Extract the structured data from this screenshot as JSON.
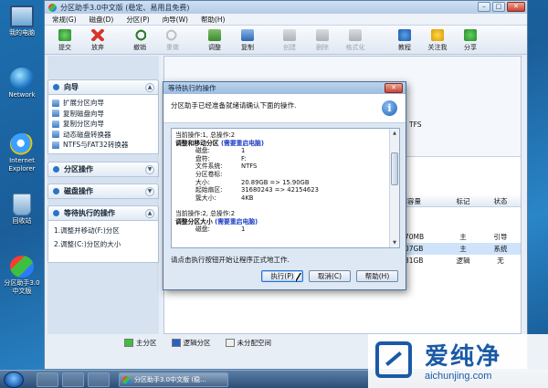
{
  "desktop": {
    "icons": [
      {
        "label": "我的电脑",
        "icon": "computer-icon"
      },
      {
        "label": "Network",
        "icon": "network-icon"
      },
      {
        "label": "Internet Explorer",
        "icon": "ie-icon"
      },
      {
        "label": "回收站",
        "icon": "recycle-bin-icon"
      },
      {
        "label": "分区助手3.0中文版",
        "icon": "partition-assistant-icon"
      }
    ]
  },
  "window": {
    "title": "分区助手3.0中文版 (稳定、易用且免费)",
    "menu": [
      "常规(G)",
      "磁盘(D)",
      "分区(P)",
      "向导(W)",
      "帮助(H)"
    ],
    "toolbar": [
      {
        "label": "提交",
        "icon": "commit-icon",
        "enabled": true
      },
      {
        "label": "放弃",
        "icon": "discard-icon",
        "enabled": true
      },
      {
        "label": "撤销",
        "icon": "undo-icon",
        "enabled": true
      },
      {
        "label": "重做",
        "icon": "redo-icon",
        "enabled": false
      },
      {
        "label": "调整",
        "icon": "resize-icon",
        "enabled": true
      },
      {
        "label": "复制",
        "icon": "copy-icon",
        "enabled": true
      },
      {
        "label": "创建",
        "icon": "create-icon",
        "enabled": false
      },
      {
        "label": "删除",
        "icon": "delete-icon",
        "enabled": false
      },
      {
        "label": "格式化",
        "icon": "format-icon",
        "enabled": false
      },
      {
        "label": "教程",
        "icon": "tutorial-icon",
        "enabled": true
      },
      {
        "label": "关注我",
        "icon": "follow-icon",
        "enabled": true
      },
      {
        "label": "分享",
        "icon": "share-icon",
        "enabled": true
      }
    ]
  },
  "left": {
    "wizard_title": "向导",
    "wizard_items": [
      "扩展分区向导",
      "复制磁盘向导",
      "复制分区向导",
      "动态磁盘转换器",
      "NTFS与FAT32转换器"
    ],
    "partition_ops_title": "分区操作",
    "disk_ops_title": "磁盘操作",
    "pending_title": "等待执行的操作",
    "pending_items": [
      "1.调整并移动(F:)分区",
      "2.调整(C:)分区的大小"
    ]
  },
  "table": {
    "headers": [
      "",
      "未用容量",
      "标记",
      "状态"
    ],
    "rows": [
      {
        "name": "",
        "unused": "75.70MB",
        "flag": "主",
        "status": "引导"
      },
      {
        "name": "",
        "unused": "13.07GB",
        "flag": "主",
        "status": "系统"
      },
      {
        "name": "",
        "unused": "15.81GB",
        "flag": "逻辑",
        "status": "无"
      }
    ],
    "fs_hint": "TFS"
  },
  "legend": [
    "主分区",
    "逻辑分区",
    "未分配空间"
  ],
  "dialog": {
    "title": "等待执行的操作",
    "header_text": "分区助手已经准备就绪请确认下面的操作.",
    "ops": [
      {
        "counter": "当前操作:1, 总操作:2",
        "name": "调整和移动分区",
        "hint": "(需要重启电脑)",
        "fields": [
          [
            "磁盘:",
            "1"
          ],
          [
            "盘符:",
            "F:"
          ],
          [
            "文件系统:",
            "NTFS"
          ],
          [
            "分区卷标:",
            ""
          ],
          [
            "大小:",
            "20.89GB => 15.90GB"
          ],
          [
            "起始扇区:",
            "31680243 => 42154623"
          ],
          [
            "簇大小:",
            "4KB"
          ]
        ]
      },
      {
        "counter": "当前操作:2, 总操作:2",
        "name": "调整分区大小",
        "hint": "(需要重启电脑)",
        "fields": [
          [
            "磁盘:",
            "1"
          ]
        ]
      }
    ],
    "note": "请点击执行按钮开始让程序正式地工作.",
    "buttons": {
      "execute": "执行(P)",
      "cancel": "取消(C)",
      "help": "帮助(H)"
    }
  },
  "taskbar": {
    "task_label": "分区助手3.0中文版 (稳..."
  },
  "watermark": {
    "title": "爱纯净",
    "url": "aichunjing.com"
  }
}
